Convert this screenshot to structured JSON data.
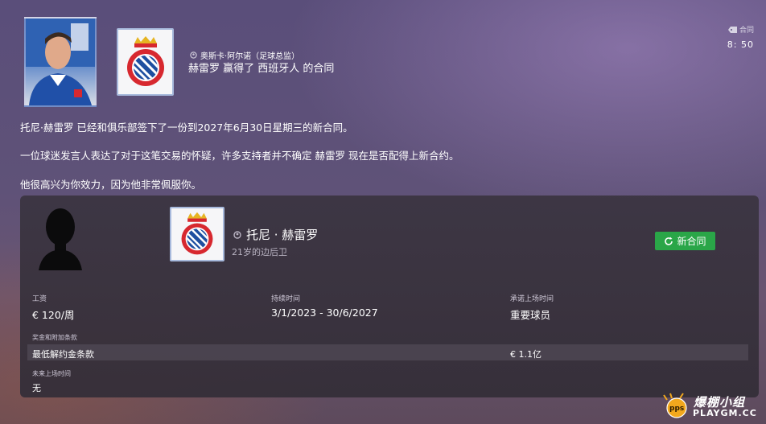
{
  "message": {
    "sender_name": "奥斯卡·阿尔诺（足球总监）",
    "headline": "赫雷罗 赢得了 西班牙人 的合同",
    "tag": "合同",
    "time": "8: 50",
    "paragraphs": [
      "托尼·赫雷罗 已经和俱乐部签下了一份到2027年6月30日星期三的新合同。",
      "一位球迷发言人表达了对于这笔交易的怀疑，许多支持者并不确定 赫雷罗 现在是否配得上新合约。",
      "他很高兴为你效力，因为他非常佩服你。"
    ]
  },
  "contract_card": {
    "player_name": "托尼 · 赫雷罗",
    "player_sub": "21岁的边后卫",
    "button_label": "新合同",
    "wage_label": "工资",
    "wage_value": "€ 120/周",
    "duration_label": "持续时间",
    "duration_value": "3/1/2023 - 30/6/2027",
    "playing_time_label": "承诺上场时间",
    "playing_time_value": "重要球员",
    "bonus_label": "奖金和附加条款",
    "release_clause_label": "最低解约金条款",
    "release_clause_value": "€ 1.1亿",
    "future_time_label": "未来上场时间",
    "future_time_value": "无"
  },
  "watermark": {
    "title": "爆棚小组",
    "domain": "PLAYGM.CC",
    "badge": "pps"
  },
  "colors": {
    "button_green": "#2aa648",
    "crest_blue": "#1e4fa0",
    "crest_red": "#d7282f",
    "crest_gold": "#e6b422"
  },
  "icons": {
    "person": "person-icon",
    "tag": "tag-icon",
    "refresh": "refresh-icon",
    "crest": "espanyol-crest-icon"
  }
}
